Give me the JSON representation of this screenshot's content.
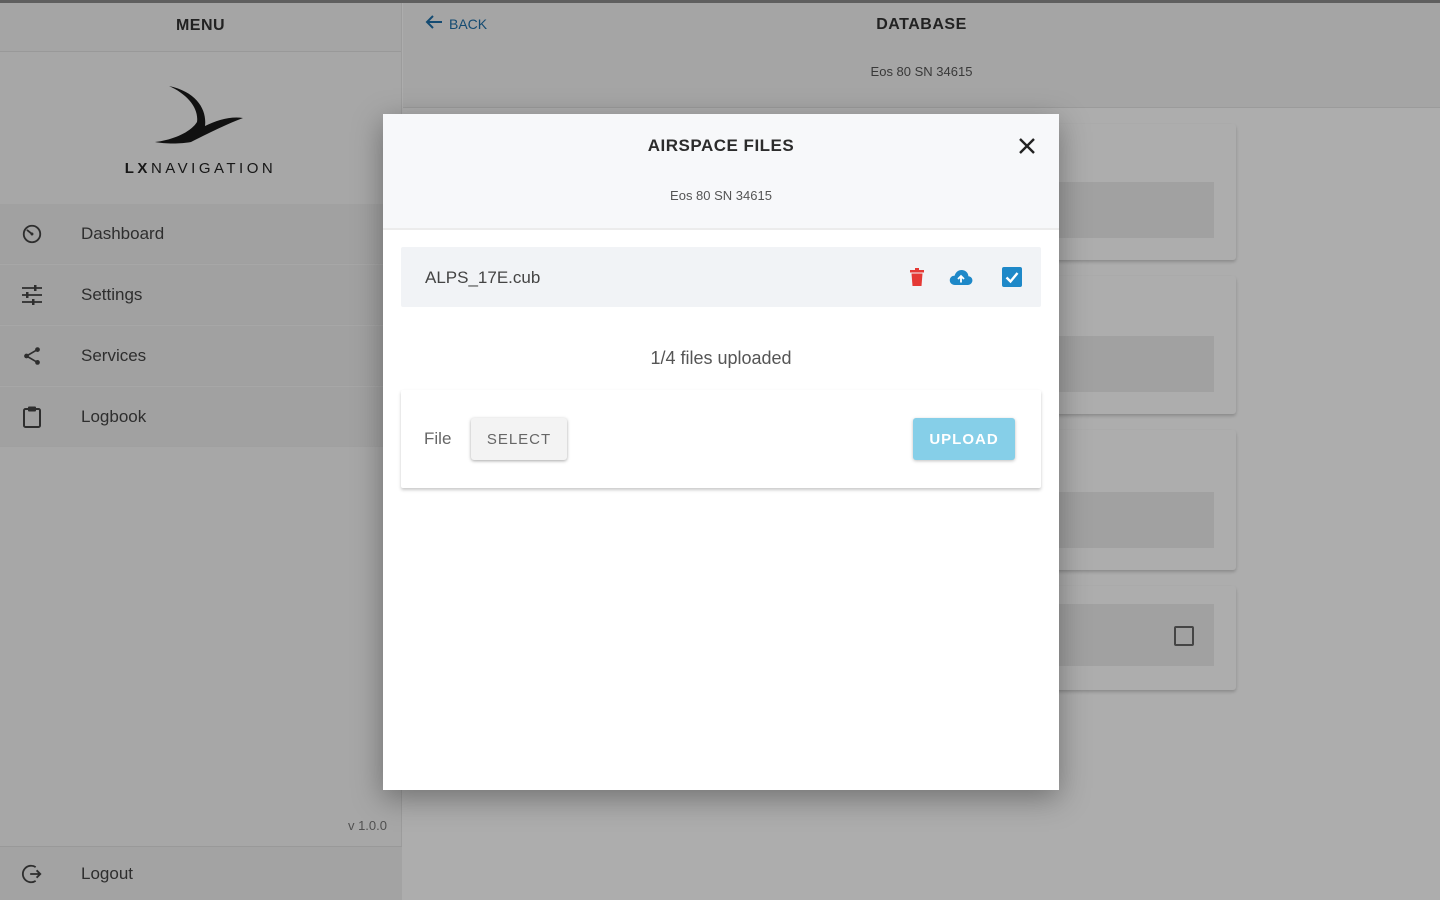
{
  "sidebar": {
    "title": "MENU",
    "logo_text_bold": "LX",
    "logo_text_rest": "NAVIGATION",
    "items": [
      {
        "label": "Dashboard",
        "icon": "speedometer-icon"
      },
      {
        "label": "Settings",
        "icon": "sliders-icon"
      },
      {
        "label": "Services",
        "icon": "share-icon"
      },
      {
        "label": "Logbook",
        "icon": "clipboard-icon"
      }
    ],
    "version": "v 1.0.0",
    "logout_label": "Logout"
  },
  "main": {
    "back_label": "BACK",
    "title": "DATABASE",
    "subtitle": "Eos 80 SN 34615"
  },
  "modal": {
    "title": "AIRSPACE FILES",
    "subtitle": "Eos 80 SN 34615",
    "files": [
      {
        "name": "ALPS_17E.cub",
        "checked": true
      }
    ],
    "upload_status": "1/4 files uploaded",
    "file_label": "File",
    "select_label": "SELECT",
    "upload_label": "UPLOAD"
  },
  "colors": {
    "accent_blue": "#1e88c8",
    "upload_button": "#86cfe8",
    "delete_red": "#e53935",
    "back_link": "#1e6fa8"
  }
}
